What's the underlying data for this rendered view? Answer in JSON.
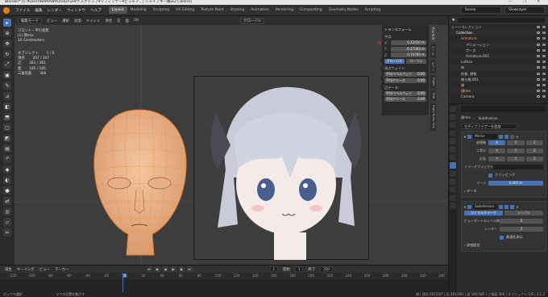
{
  "window": {
    "title": "Blender* [C:¥Users¥B¥¥AW¥OneDrive¥デスクトップ¥ソフィンデー¥ピッチア...] シャイプキー練み2 [.blend]",
    "controls": "— ❐ ✕"
  },
  "menu": [
    "ファイル",
    "編集",
    "レンダー",
    "ウィンドウ",
    "ヘルプ"
  ],
  "workspaces": [
    {
      "label": "Layout",
      "active": true
    },
    {
      "label": "Modeling",
      "active": false
    },
    {
      "label": "Sculpting",
      "active": false
    },
    {
      "label": "UV Editing",
      "active": false
    },
    {
      "label": "Texture Paint",
      "active": false
    },
    {
      "label": "Shading",
      "active": false
    },
    {
      "label": "Animation",
      "active": false
    },
    {
      "label": "Rendering",
      "active": false
    },
    {
      "label": "Compositing",
      "active": false
    },
    {
      "label": "Geometry Nodes",
      "active": false
    },
    {
      "label": "Scripting",
      "active": false
    }
  ],
  "scene": {
    "scene_label": "Scene",
    "viewlayer_label": "ViewLayer"
  },
  "viewport": {
    "header": [
      "編集モード",
      "ビュー",
      "選択",
      "追加",
      "メッシュ",
      "頂点",
      "辺",
      "面",
      "UV"
    ],
    "overlay_mode": "グローバル",
    "info_lines": [
      "フロント・平行投影",
      "(1) 顔mix",
      "10 Centimeters"
    ],
    "stats": [
      {
        "label": "オブジェクト",
        "value": "1 / 6"
      },
      {
        "label": "頂点",
        "value": "207 / 207"
      },
      {
        "label": "辺",
        "value": "381 / 381"
      },
      {
        "label": "面",
        "value": "185 / 185"
      },
      {
        "label": "三角形面",
        "value": "366"
      }
    ]
  },
  "npanel": {
    "section": "トランスフォーム",
    "sub_median": "中点:",
    "rows": [
      {
        "label": "X",
        "value": "0.22410 m"
      },
      {
        "label": "Y",
        "value": "-0.27393 m"
      },
      {
        "label": "Z",
        "value": "0.74769 m"
      }
    ],
    "global_label": "グローバル",
    "local_label": "ローカル",
    "vertex_label": "頂点ウェイト:",
    "bevel_weight_label": "平均ベベルウェイト",
    "bevel_weight_value": "0.00",
    "crease_label": "平均クリース",
    "crease_value": "0.00",
    "edge_label": "辺データ:",
    "edge_bevel_value": "0.00",
    "edge_crease_value": "0.00",
    "tabs": [
      "アイテム",
      "ツール",
      "ビュー",
      "Rigify",
      "Edit",
      "Rigid Body Gen"
    ]
  },
  "timeline": {
    "menus": [
      "再生",
      "キーイング",
      "ビュー",
      "マーカー"
    ],
    "current_frame": "1",
    "start_label": "開始",
    "start": "1",
    "end_label": "終了",
    "end": "250",
    "ticks": [
      "-120",
      "-100",
      "-80",
      "-60",
      "-40",
      "-20",
      "0",
      "20",
      "40",
      "60",
      "80",
      "100",
      "120",
      "140",
      "160",
      "180",
      "200",
      "220",
      "240",
      "260",
      "280",
      "300",
      "320",
      "340"
    ]
  },
  "statusbar": {
    "left": "ボックス選択",
    "mid": "マウス位置を動かす",
    "right": "顔 | 頂点:207/207 | 辺:381/381 | 面:185/185 | 三角面:366 | オブジェクト:1/6 | 3.1.2"
  },
  "outliner": {
    "header": "シーンコレクション",
    "items": [
      {
        "label": "シーンコレクション",
        "indent": 0,
        "color": "#c8c8c8"
      },
      {
        "label": "Collection",
        "indent": 1,
        "color": "#ffffff"
      },
      {
        "label": "Armature",
        "indent": 2,
        "color": "#e4a060"
      },
      {
        "label": "アニメーション",
        "indent": 3,
        "color": "#c8c8c8"
      },
      {
        "label": "ポーズ",
        "indent": 3,
        "color": "#c8c8c8"
      },
      {
        "label": "Armature.001",
        "indent": 3,
        "color": "#c8c8c8"
      },
      {
        "label": "Lattice",
        "indent": 2,
        "color": "#c8c8c8"
      },
      {
        "label": "体",
        "indent": 2,
        "color": "#c8c8c8"
      },
      {
        "label": "前髪, 横髪",
        "indent": 2,
        "color": "#c8c8c8"
      },
      {
        "label": "後ろ髪.001",
        "indent": 2,
        "color": "#c8c8c8"
      },
      {
        "label": "顔",
        "indent": 2,
        "color": "#c8c8c8"
      },
      {
        "label": "顔mix",
        "indent": 2,
        "color": "#ffb464"
      },
      {
        "label": "Camera",
        "indent": 2,
        "color": "#c8c8c8"
      }
    ]
  },
  "properties": {
    "object_name": "顔mix",
    "modifier_name_top": "Subdivision",
    "add_modifier": "モディファイアーを追加",
    "mirror": {
      "name": "Mirror",
      "axis_label": "座標軸",
      "bisect_label": "二等分",
      "flip_label": "反転",
      "axes": [
        "X",
        "Y",
        "Z"
      ],
      "mirror_object_label": "ミラーオブジェクト",
      "clipping_label": "クリッピング",
      "merge_label": "マージ",
      "merge_value": "0.001 m",
      "data_label": "データ"
    },
    "subdivision": {
      "name": "Subdivision",
      "catmull": "カトマルクラーク",
      "simple": "シンプル",
      "viewport_label": "ビューポートのレベル数",
      "viewport_value": "2",
      "render_label": "レンダー",
      "render_value": "2",
      "optimal_label": "最適化表示",
      "advanced_label": "詳細設定"
    }
  },
  "colors": {
    "accent": "#4772b3",
    "active_object": "#ffb464",
    "viewport_bg": "#3d3d3d"
  }
}
